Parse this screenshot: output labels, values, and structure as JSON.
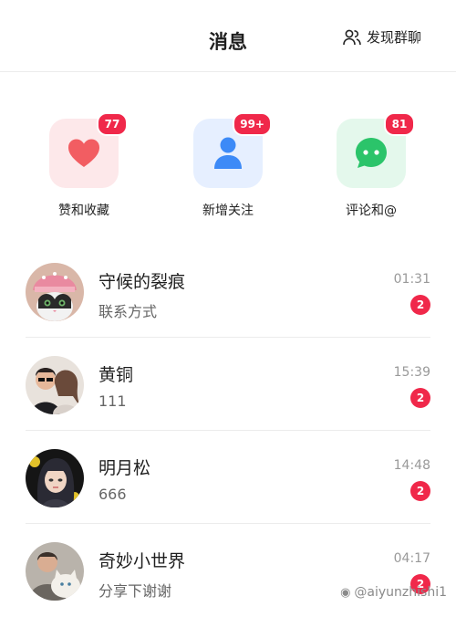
{
  "header": {
    "title": "消息",
    "discover_label": "发现群聊"
  },
  "quick_actions": [
    {
      "label": "赞和收藏",
      "badge": "77",
      "icon": "heart-icon",
      "color": "#f25d62",
      "tile_bg": "#fde8ea"
    },
    {
      "label": "新增关注",
      "badge": "99+",
      "icon": "user-icon",
      "color": "#3d8af7",
      "tile_bg": "#e6efff"
    },
    {
      "label": "评论和@",
      "badge": "81",
      "icon": "chat-icon",
      "color": "#2bc46a",
      "tile_bg": "#e4f8ec"
    }
  ],
  "conversations": [
    {
      "name": "守候的裂痕",
      "preview": "联系方式",
      "time": "01:31",
      "unread": "2"
    },
    {
      "name": "黄铜",
      "preview": "111",
      "time": "15:39",
      "unread": "2"
    },
    {
      "name": "明月松",
      "preview": "666",
      "time": "14:48",
      "unread": "2"
    },
    {
      "name": "奇妙小世界",
      "preview": "分享下谢谢",
      "time": "04:17",
      "unread": "2"
    }
  ],
  "watermark": "@aiyunzhishi1",
  "colors": {
    "badge": "#f0284a"
  }
}
